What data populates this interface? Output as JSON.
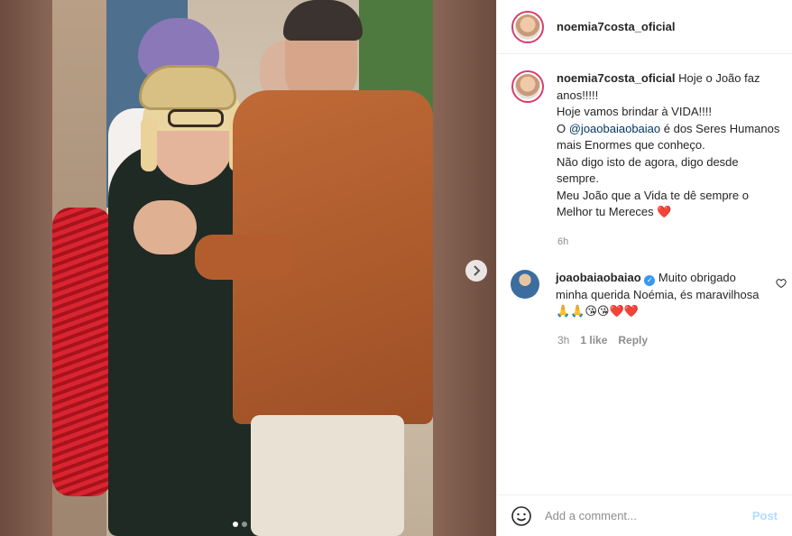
{
  "post": {
    "username": "noemia7costa_oficial"
  },
  "caption": {
    "username": "noemia7costa_oficial",
    "line1": "Hoje o João faz anos!!!!!",
    "line2": "Hoje vamos brindar à VIDA!!!!",
    "line3_prefix": "O ",
    "line3_mention": "@joaobaiaobaiao",
    "line3_suffix": " é dos Seres Humanos mais Enormes que conheço.",
    "line4": "Não digo isto de agora, digo desde sempre.",
    "line5": "Meu João que a Vida te dê sempre o Melhor tu Mereces",
    "emoji": "❤️",
    "time": "6h"
  },
  "reply": {
    "username": "joaobaiaobaiao",
    "text": "Muito obrigado minha querida Noémia, és maravilhosa",
    "emojis": "🙏🙏😘😘❤️❤️",
    "time": "3h",
    "likes": "1 like",
    "reply_label": "Reply"
  },
  "comment_box": {
    "placeholder": "Add a comment...",
    "post_label": "Post"
  },
  "icons": {
    "next": "chevron-right-icon",
    "like": "heart-outline-icon",
    "emoji": "smiley-icon",
    "verified": "verified-badge-icon"
  },
  "colors": {
    "accent_ring": "#d63e6b",
    "mention": "#00376b",
    "post_disabled": "#b3dbff",
    "verified": "#3897f0"
  },
  "carousel": {
    "slide": 1,
    "slides": 2
  }
}
